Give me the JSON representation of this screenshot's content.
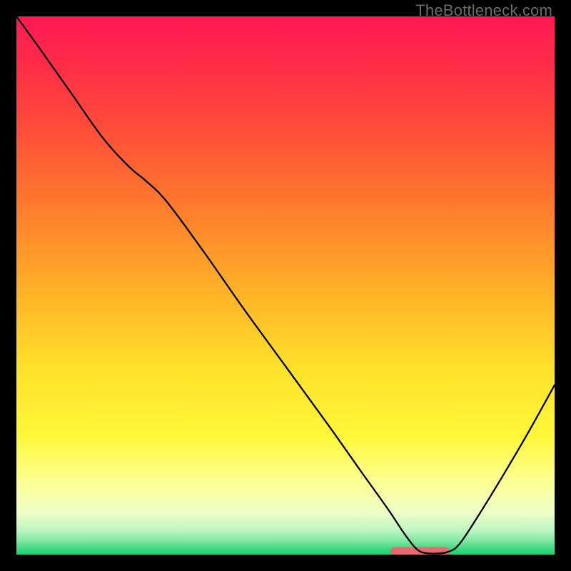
{
  "watermark": "TheBottleneck.com",
  "chart_data": {
    "type": "line",
    "title": "",
    "xlabel": "",
    "ylabel": "",
    "xlim": [
      0,
      100
    ],
    "ylim": [
      0,
      100
    ],
    "background_gradient": {
      "stops": [
        {
          "offset": 0.0,
          "color": "#ff1a52"
        },
        {
          "offset": 0.08,
          "color": "#ff2a4a"
        },
        {
          "offset": 0.2,
          "color": "#ff4a3a"
        },
        {
          "offset": 0.35,
          "color": "#ff7a2e"
        },
        {
          "offset": 0.5,
          "color": "#ffae28"
        },
        {
          "offset": 0.65,
          "color": "#ffe02a"
        },
        {
          "offset": 0.78,
          "color": "#fff83a"
        },
        {
          "offset": 0.86,
          "color": "#fdff8f"
        },
        {
          "offset": 0.92,
          "color": "#efffc5"
        },
        {
          "offset": 0.955,
          "color": "#bdf5c3"
        },
        {
          "offset": 0.975,
          "color": "#7de7a0"
        },
        {
          "offset": 0.99,
          "color": "#38d97c"
        },
        {
          "offset": 1.0,
          "color": "#1fd070"
        }
      ]
    },
    "series": [
      {
        "name": "bottleneck-curve",
        "stroke": "#000000",
        "stroke_width": 2.3,
        "points": [
          {
            "x": 0.0,
            "y": 100.0
          },
          {
            "x": 4.0,
            "y": 94.5
          },
          {
            "x": 10.0,
            "y": 86.0
          },
          {
            "x": 16.0,
            "y": 77.5
          },
          {
            "x": 21.0,
            "y": 72.0
          },
          {
            "x": 24.0,
            "y": 69.5
          },
          {
            "x": 28.0,
            "y": 65.5
          },
          {
            "x": 35.0,
            "y": 56.0
          },
          {
            "x": 42.0,
            "y": 46.0
          },
          {
            "x": 50.0,
            "y": 35.0
          },
          {
            "x": 58.0,
            "y": 24.0
          },
          {
            "x": 64.0,
            "y": 15.5
          },
          {
            "x": 69.0,
            "y": 8.5
          },
          {
            "x": 72.0,
            "y": 4.0
          },
          {
            "x": 74.0,
            "y": 1.4
          },
          {
            "x": 75.5,
            "y": 0.4
          },
          {
            "x": 78.0,
            "y": 0.2
          },
          {
            "x": 80.5,
            "y": 0.6
          },
          {
            "x": 82.5,
            "y": 2.2
          },
          {
            "x": 86.0,
            "y": 7.5
          },
          {
            "x": 90.0,
            "y": 14.0
          },
          {
            "x": 95.0,
            "y": 22.5
          },
          {
            "x": 100.0,
            "y": 31.5
          }
        ]
      }
    ],
    "markers": [
      {
        "name": "optimal-zone",
        "shape": "rounded-rect",
        "fill": "#e66a6f",
        "x_start": 69.5,
        "x_end": 80.5,
        "y": 0.6,
        "height_pct": 1.6
      }
    ]
  }
}
